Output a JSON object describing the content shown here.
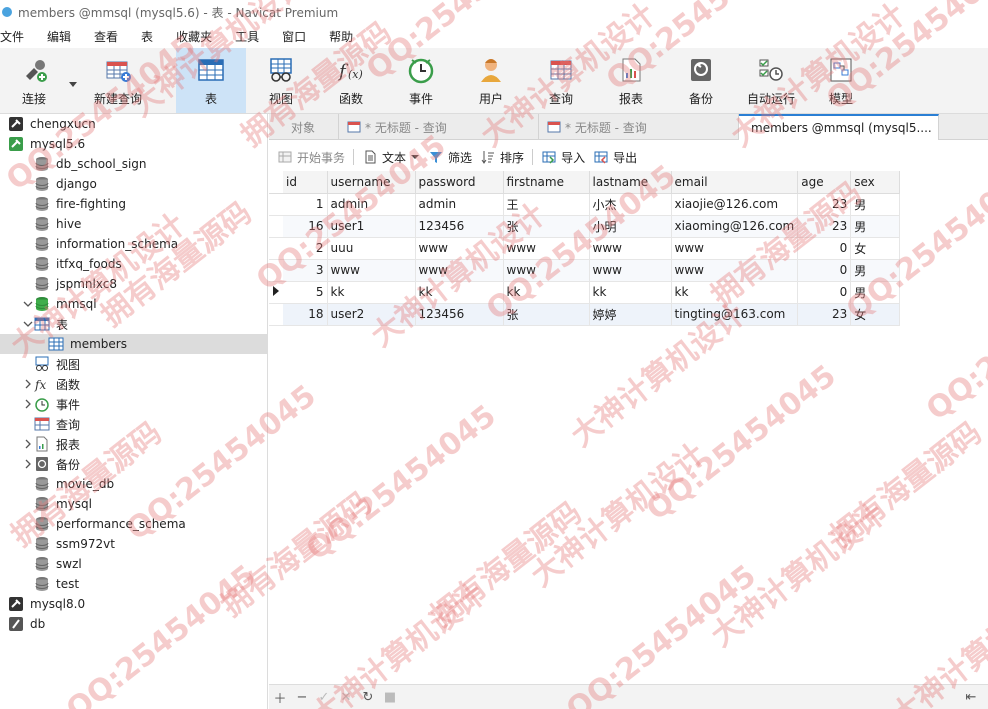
{
  "window": {
    "title": "members @mmsql (mysql5.6) - 表 - Navicat Premium"
  },
  "menu": [
    "文件",
    "编辑",
    "查看",
    "表",
    "收藏夹",
    "工具",
    "窗口",
    "帮助"
  ],
  "toolbar": {
    "items": [
      {
        "label": "连接",
        "icon": "connection-icon"
      },
      {
        "label": "新建查询",
        "icon": "new-query-icon"
      },
      {
        "label": "表",
        "icon": "table-icon",
        "active": true
      },
      {
        "label": "视图",
        "icon": "view-icon"
      },
      {
        "label": "函数",
        "icon": "function-icon"
      },
      {
        "label": "事件",
        "icon": "event-icon"
      },
      {
        "label": "用户",
        "icon": "user-icon"
      },
      {
        "label": "查询",
        "icon": "query-icon"
      },
      {
        "label": "报表",
        "icon": "report-icon"
      },
      {
        "label": "备份",
        "icon": "backup-icon"
      },
      {
        "label": "自动运行",
        "icon": "autorun-icon"
      },
      {
        "label": "模型",
        "icon": "model-icon"
      }
    ]
  },
  "sidebar": {
    "rows": [
      {
        "label": "chengxucn",
        "level": 0,
        "icon": "connection-icon",
        "arrow": ""
      },
      {
        "label": "mysql5.6",
        "level": 0,
        "icon": "connection-open-icon",
        "arrow": "v"
      },
      {
        "label": "db_school_sign",
        "level": 1,
        "icon": "database-icon",
        "arrow": ""
      },
      {
        "label": "django",
        "level": 1,
        "icon": "database-icon",
        "arrow": ""
      },
      {
        "label": "fire-fighting",
        "level": 1,
        "icon": "database-icon",
        "arrow": ""
      },
      {
        "label": "hive",
        "level": 1,
        "icon": "database-icon",
        "arrow": ""
      },
      {
        "label": "information_schema",
        "level": 1,
        "icon": "database-icon",
        "arrow": ""
      },
      {
        "label": "itfxq_foods",
        "level": 1,
        "icon": "database-icon",
        "arrow": ""
      },
      {
        "label": "jspmnlxc8",
        "level": 1,
        "icon": "database-icon",
        "arrow": ""
      },
      {
        "label": "mmsql",
        "level": 1,
        "icon": "database-open-icon",
        "arrow": "v"
      },
      {
        "label": "表",
        "level": 2,
        "icon": "table-folder-icon",
        "arrow": "v"
      },
      {
        "label": "members",
        "level": 3,
        "icon": "table-icon",
        "arrow": "",
        "selected": true
      },
      {
        "label": "视图",
        "level": 2,
        "icon": "view-folder-icon",
        "arrow": ""
      },
      {
        "label": "函数",
        "level": 2,
        "icon": "function-icon",
        "arrow": ">"
      },
      {
        "label": "事件",
        "level": 2,
        "icon": "event-icon",
        "arrow": ">"
      },
      {
        "label": "查询",
        "level": 2,
        "icon": "query-icon",
        "arrow": ""
      },
      {
        "label": "报表",
        "level": 2,
        "icon": "report-icon",
        "arrow": ">"
      },
      {
        "label": "备份",
        "level": 2,
        "icon": "backup-icon",
        "arrow": ">"
      },
      {
        "label": "movie_db",
        "level": 1,
        "icon": "database-icon",
        "arrow": ""
      },
      {
        "label": "mysql",
        "level": 1,
        "icon": "database-icon",
        "arrow": ""
      },
      {
        "label": "performance_schema",
        "level": 1,
        "icon": "database-icon",
        "arrow": ""
      },
      {
        "label": "ssm972vt",
        "level": 1,
        "icon": "database-icon",
        "arrow": ""
      },
      {
        "label": "swzl",
        "level": 1,
        "icon": "database-icon",
        "arrow": ""
      },
      {
        "label": "test",
        "level": 1,
        "icon": "database-icon",
        "arrow": ""
      },
      {
        "label": "mysql8.0",
        "level": 0,
        "icon": "connection-icon",
        "arrow": ""
      },
      {
        "label": "db",
        "level": 0,
        "icon": "db-file-icon",
        "arrow": ""
      }
    ]
  },
  "tabs": [
    {
      "label": "对象",
      "active": false
    },
    {
      "label": "* 无标题 - 查询",
      "active": false
    },
    {
      "label": "* 无标题 - 查询",
      "active": false
    },
    {
      "label": "members @mmsql (mysql5....",
      "active": true
    }
  ],
  "subtoolbar": {
    "begin_tx": "开始事务",
    "text": "文本",
    "filter": "筛选",
    "sort": "排序",
    "import": "导入",
    "export": "导出"
  },
  "table": {
    "columns": [
      "id",
      "username",
      "password",
      "firstname",
      "lastname",
      "email",
      "age",
      "sex"
    ],
    "rows": [
      [
        "1",
        "admin",
        "admin",
        "王",
        "小杰",
        "xiaojie@126.com",
        "23",
        "男"
      ],
      [
        "16",
        "user1",
        "123456",
        "张",
        "小明",
        "xiaoming@126.com",
        "23",
        "男"
      ],
      [
        "2",
        "uuu",
        "www",
        "www",
        "www",
        "www",
        "0",
        "女"
      ],
      [
        "3",
        "www",
        "www",
        "www",
        "www",
        "www",
        "0",
        "男"
      ],
      [
        "5",
        "kk",
        "kk",
        "kk",
        "kk",
        "kk",
        "0",
        "男"
      ],
      [
        "18",
        "user2",
        "123456",
        "张",
        "婷婷",
        "tingting@163.com",
        "23",
        "女"
      ]
    ],
    "current_row": 4
  },
  "watermark": [
    "QQ:25454045",
    "大神计算机设计",
    "拥有海量源码"
  ],
  "colors": {
    "accent": "#2a7fd4",
    "selected_tab_bg": "#cde3f7"
  }
}
